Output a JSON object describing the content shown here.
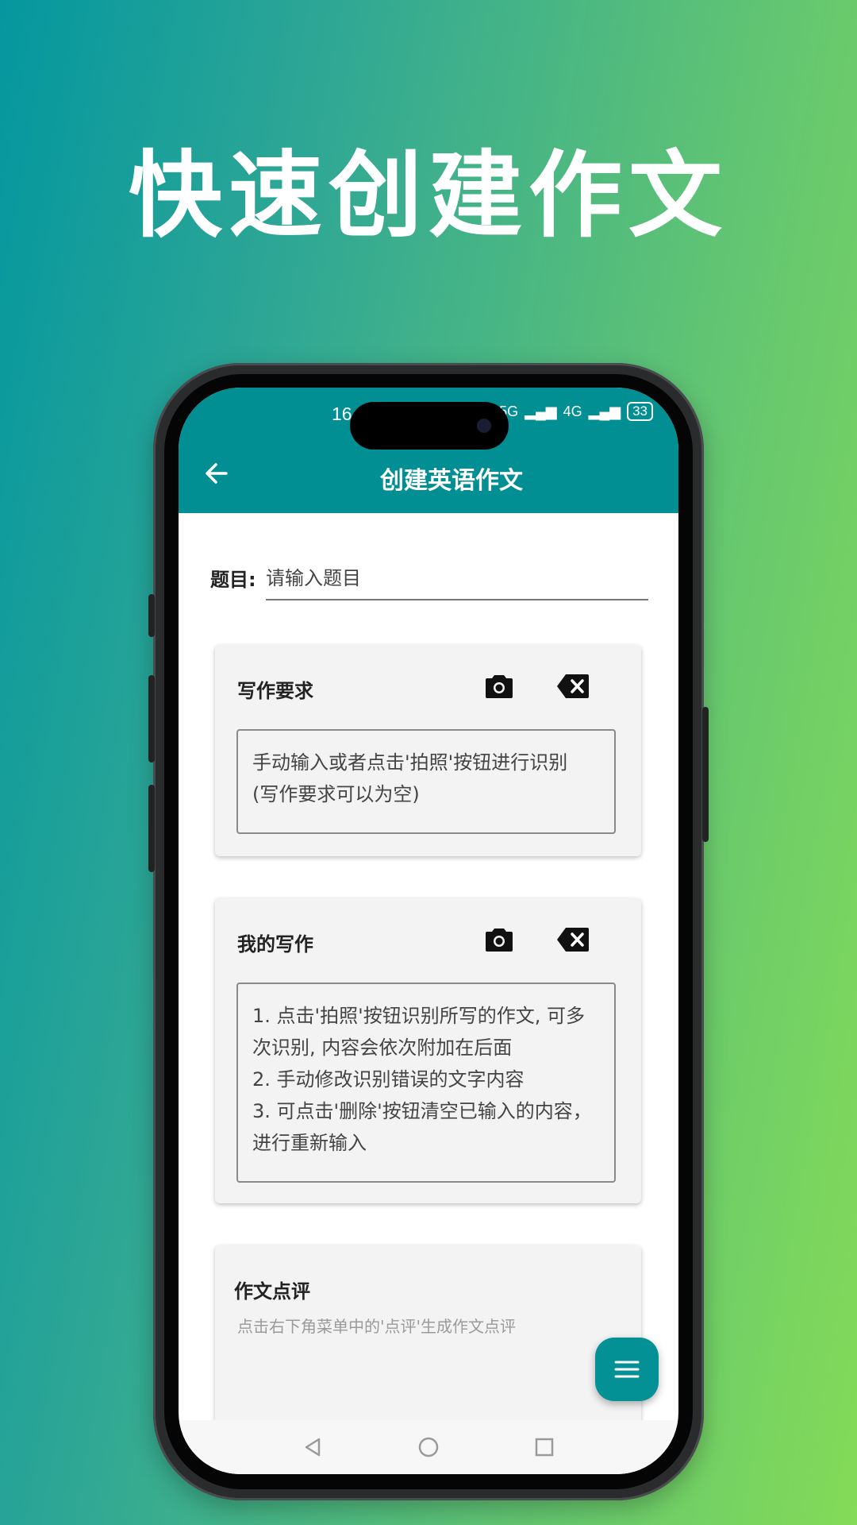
{
  "headline": "快速创建作文",
  "status": {
    "time": "16",
    "battery": "33",
    "network1": "5G",
    "network2": "4G"
  },
  "appbar": {
    "title": "创建英语作文",
    "back_icon": "arrow-left-icon"
  },
  "topic": {
    "label": "题目:",
    "placeholder": "请输入题目",
    "value": ""
  },
  "requirements_card": {
    "title": "写作要求",
    "camera_icon": "camera-icon",
    "clear_icon": "backspace-icon",
    "text": "手动输入或者点击'拍照'按钮进行识别\n(写作要求可以为空)"
  },
  "writing_card": {
    "title": "我的写作",
    "camera_icon": "camera-icon",
    "clear_icon": "backspace-icon",
    "text": "1. 点击'拍照'按钮识别所写的作文, 可多次识别, 内容会依次附加在后面\n2. 手动修改识别错误的文字内容\n3. 可点击'删除'按钮清空已输入的内容，进行重新输入"
  },
  "review_card": {
    "title": "作文点评",
    "hint": "点击右下角菜单中的'点评'生成作文点评"
  },
  "fab_icon": "menu-icon",
  "navbar": {
    "back_icon": "triangle-back-icon",
    "home_icon": "circle-home-icon",
    "recents_icon": "square-recents-icon"
  },
  "colors": {
    "primary": "#018f94",
    "card": "#f3f3f3"
  }
}
